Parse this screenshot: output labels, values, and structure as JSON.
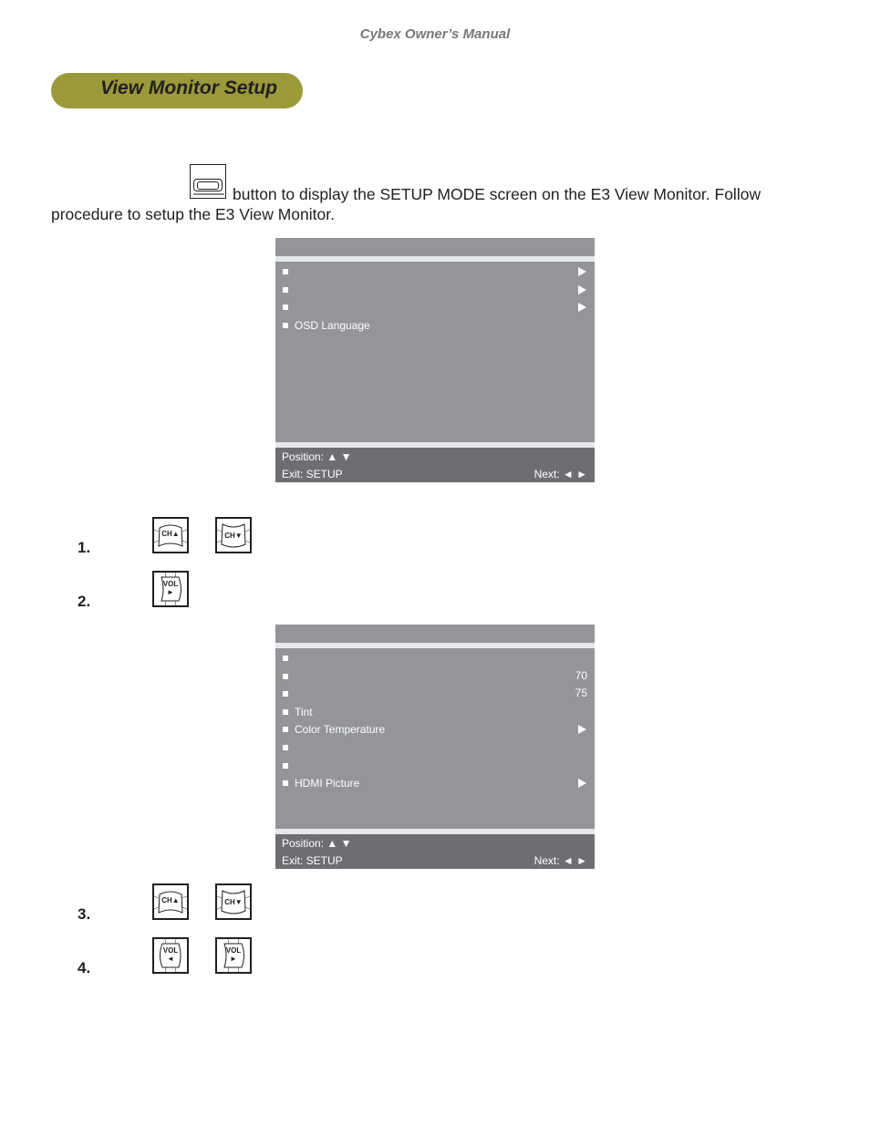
{
  "running_head": "Cybex Owner’s Manual",
  "section_title": "View Monitor Setup",
  "intro": {
    "line1": "button to display the SETUP MODE screen on the E3 View Monitor. Follow",
    "line2": "procedure to setup the E3 View Monitor.",
    "button_icon": "setup-button-icon"
  },
  "osd_main": {
    "title": "",
    "items": [
      {
        "label": "",
        "right": "arrow"
      },
      {
        "label": "",
        "right": "arrow"
      },
      {
        "label": "",
        "right": "arrow"
      },
      {
        "label": "OSD Language",
        "right": ""
      }
    ],
    "footer": {
      "position_label": "Position: ▲ ▼",
      "exit_label": "Exit: SETUP",
      "next_label": "Next: ◄ ►"
    }
  },
  "steps_a": [
    {
      "number": "1.",
      "keys": [
        {
          "label": "CH▲",
          "type": "ch-up"
        },
        {
          "label": "CH▼",
          "type": "ch-down"
        }
      ]
    },
    {
      "number": "2.",
      "keys": [
        {
          "label": "VOL ►",
          "type": "vol-right"
        }
      ]
    }
  ],
  "osd_picture": {
    "title": "",
    "items": [
      {
        "label": "",
        "right": ""
      },
      {
        "label": "",
        "right": "70"
      },
      {
        "label": "",
        "right": "75"
      },
      {
        "label": "Tint",
        "right": ""
      },
      {
        "label": "Color Temperature",
        "right": "arrow"
      },
      {
        "label": "",
        "right": ""
      },
      {
        "label": "",
        "right": ""
      },
      {
        "label": "HDMI Picture",
        "right": "arrow"
      }
    ],
    "footer": {
      "position_label": "Position: ▲ ▼",
      "exit_label": "Exit: SETUP",
      "next_label": "Next: ◄ ►"
    }
  },
  "steps_b": [
    {
      "number": "3.",
      "keys": [
        {
          "label": "CH▲",
          "type": "ch-up"
        },
        {
          "label": "CH▼",
          "type": "ch-down"
        }
      ]
    },
    {
      "number": "4.",
      "keys": [
        {
          "label": "VOL ◄",
          "type": "vol-left"
        },
        {
          "label": "VOL ►",
          "type": "vol-right"
        }
      ]
    }
  ],
  "colors": {
    "pill": "#9a9a3a",
    "osd_body": "#939598",
    "osd_footer": "#6d6e71",
    "osd_separator": "#e6e7e8",
    "running_head": "#77787b"
  }
}
